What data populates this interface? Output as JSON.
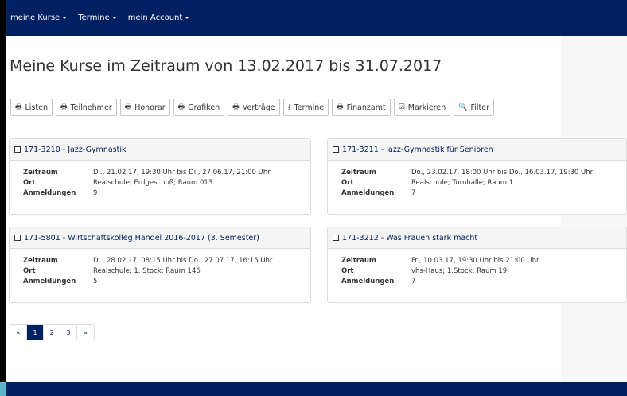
{
  "nav": {
    "items": [
      {
        "label": "meine Kurse"
      },
      {
        "label": "Termine"
      },
      {
        "label": "mein Account"
      }
    ]
  },
  "page": {
    "title": "Meine Kurse im Zeitraum von 13.02.2017 bis 31.07.2017"
  },
  "toolbar": {
    "buttons": [
      {
        "label": "Listen",
        "icon": "printer-icon"
      },
      {
        "label": "Teilnehmer",
        "icon": "printer-icon"
      },
      {
        "label": "Honorar",
        "icon": "printer-icon"
      },
      {
        "label": "Grafiken",
        "icon": "printer-icon"
      },
      {
        "label": "Verträge",
        "icon": "printer-icon"
      },
      {
        "label": "Termine",
        "icon": "download-icon"
      },
      {
        "label": "Finanzamt",
        "icon": "printer-icon"
      },
      {
        "label": "Markieren",
        "icon": "check-square-icon"
      },
      {
        "label": "Filter",
        "icon": "search-icon"
      }
    ]
  },
  "labels": {
    "zeitraum": "Zeitraum",
    "ort": "Ort",
    "anmeldungen": "Anmeldungen"
  },
  "courses": [
    {
      "title": "171-3210 - Jazz-Gymnastik",
      "zeitraum": "Di., 21.02.17, 19:30 Uhr bis Di., 27.06.17, 21:00 Uhr",
      "ort": "Realschule; Erdgeschoß; Raum 013",
      "anmeldungen": "9"
    },
    {
      "title": "171-3211 - Jazz-Gymnastik für Senioren",
      "zeitraum": "Do., 23.02.17, 18:00 Uhr bis Do., 16.03.17, 19:30 Uhr",
      "ort": "Realschule; Turnhalle; Raum 1",
      "anmeldungen": "7"
    },
    {
      "title": "171-5801 - Wirtschaftskolleg Handel 2016-2017 (3. Semester)",
      "zeitraum": "Di., 28.02.17, 08:15 Uhr bis Do., 27.07.17, 16:15 Uhr",
      "ort": "Realschule; 1. Stock; Raum 146",
      "anmeldungen": "5"
    },
    {
      "title": "171-3212 - Was Frauen stark macht",
      "zeitraum": "Fr., 10.03.17, 19:30 Uhr bis 21:00 Uhr",
      "ort": "vhs-Haus; 1.Stock; Raum 19",
      "anmeldungen": "7"
    }
  ],
  "pagination": {
    "prev": "«",
    "pages": [
      "1",
      "2",
      "3"
    ],
    "next": "»",
    "current": "1"
  },
  "colors": {
    "navbar": "#012062",
    "accent": "#012062"
  }
}
